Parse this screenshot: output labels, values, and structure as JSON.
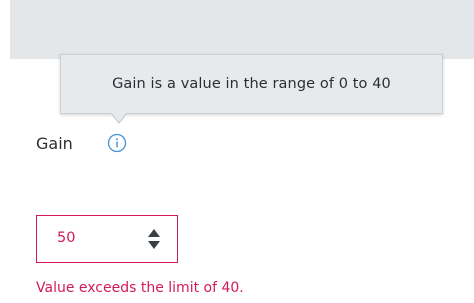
{
  "tooltip": {
    "text": "Gain is a value in the range of 0 to 40"
  },
  "field": {
    "label": "Gain",
    "value": "50",
    "error": "Value exceeds the limit of 40."
  },
  "icons": {
    "info": "info-icon",
    "stepper": "up-down-arrows-icon"
  },
  "colors": {
    "error": "#d3195b",
    "info": "#4a90d9",
    "tooltip_bg": "#e6eaed",
    "top_bar_bg": "#e3e7ea"
  }
}
